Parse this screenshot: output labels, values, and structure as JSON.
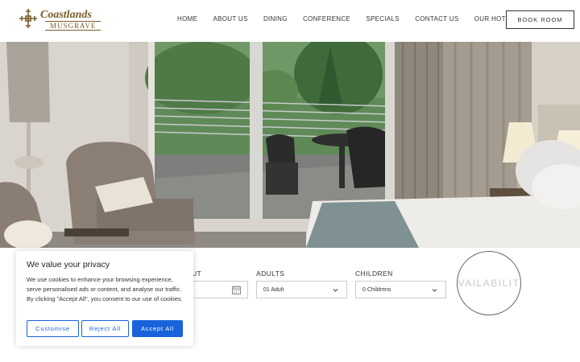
{
  "logo": {
    "name": "Coastlands",
    "sub": "MUSGRAVE"
  },
  "nav": [
    "HOME",
    "ABOUT US",
    "DINING",
    "CONFERENCE",
    "SPECIALS",
    "CONTACT US",
    "OUR HOTELS"
  ],
  "header": {
    "book_button": "BOOK ROOM"
  },
  "booking": {
    "checkout_label_partial": "UT",
    "adults_label": "ADULTS",
    "adults_value": "01 Adult",
    "children_label": "CHILDREN",
    "children_value": "0 Childrens",
    "availability_partial": "VAILABILIT"
  },
  "cookie": {
    "title": "We value your privacy",
    "text": "We use cookies to enhance your browsing experience, serve personalised ads or content, and analyse our traffic. By clicking \"Accept All\", you consent to our use of cookies.",
    "customise": "Customise",
    "reject": "Reject All",
    "accept": "Accept All"
  },
  "colors": {
    "brand_gold": "#7a5c2a",
    "cookie_blue": "#1863dc"
  }
}
